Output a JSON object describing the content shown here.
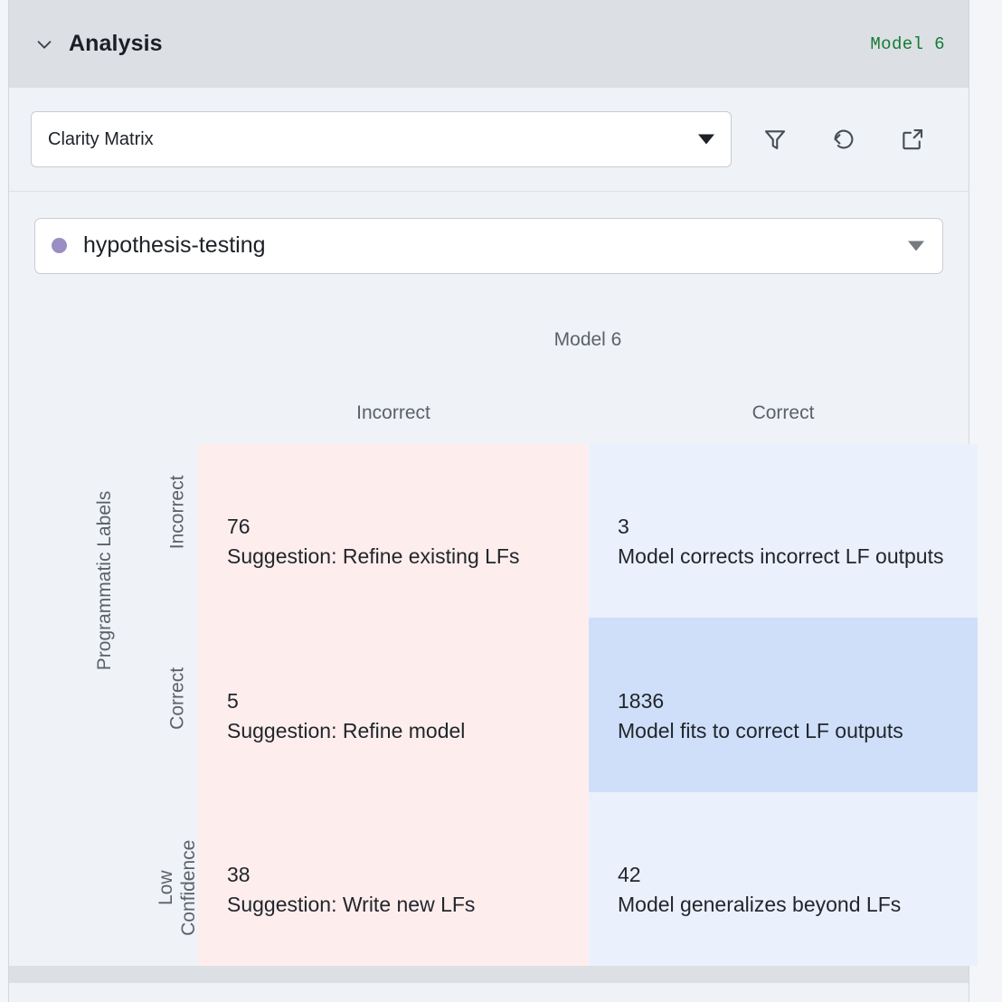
{
  "header": {
    "collapse_icon": "chevron-down-icon",
    "title": "Analysis",
    "model_badge": "Model 6"
  },
  "toolbar": {
    "view_select": {
      "value": "Clarity Matrix",
      "caret_icon": "triangle-down-icon"
    },
    "actions": [
      {
        "name": "filter-icon",
        "label": "Filter"
      },
      {
        "name": "reset-icon",
        "label": "Reset"
      },
      {
        "name": "external-link-icon",
        "label": "Open in new window"
      }
    ]
  },
  "tag_select": {
    "dot_color": "#9b8ec4",
    "value": "hypothesis-testing",
    "caret_icon": "triangle-down-icon"
  },
  "matrix": {
    "column_group_title": "Model 6",
    "row_group_title": "Programmatic Labels",
    "column_headers": [
      "Incorrect",
      "Correct"
    ],
    "row_headers": [
      "Incorrect",
      "Correct",
      "Low\nConfidence"
    ],
    "row_headers_display": [
      "Incorrect",
      "Correct",
      "Low Confidence"
    ],
    "cells": [
      [
        {
          "count": "76",
          "description": "Suggestion: Refine existing LFs",
          "tone": "pink"
        },
        {
          "count": "3",
          "description": "Model corrects incorrect LF outputs",
          "tone": "blue-light"
        }
      ],
      [
        {
          "count": "5",
          "description": "Suggestion: Refine model",
          "tone": "pink"
        },
        {
          "count": "1836",
          "description": "Model fits to correct LF outputs",
          "tone": "blue-dark"
        }
      ],
      [
        {
          "count": "38",
          "description": "Suggestion: Write new LFs",
          "tone": "pink"
        },
        {
          "count": "42",
          "description": "Model generalizes beyond LFs",
          "tone": "blue-light"
        }
      ]
    ]
  },
  "colors": {
    "header_bg": "#dcdfe3",
    "panel_bg": "#eff2f7",
    "accent_green": "#157a37",
    "tone_pink": "#fdeeed",
    "tone_blue_light": "#eaf1fc",
    "tone_blue_dark": "#cfdffa",
    "tag_dot": "#9b8ec4"
  }
}
